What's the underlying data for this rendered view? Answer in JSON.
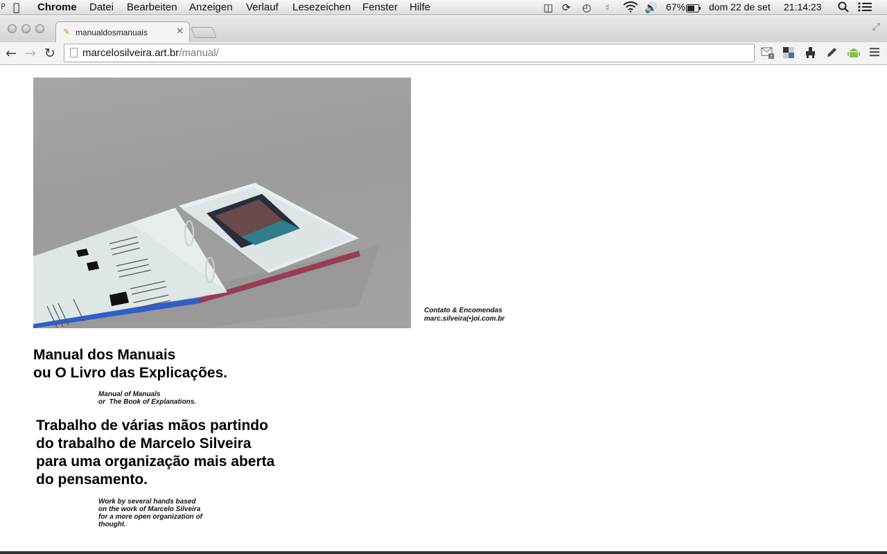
{
  "menubar": {
    "app": "Chrome",
    "items": [
      "Datei",
      "Bearbeiten",
      "Anzeigen",
      "Verlauf",
      "Lesezeichen",
      "Fenster",
      "Hilfe"
    ],
    "battery": "67%",
    "date": "dom 22 de set",
    "time": "21:14:23",
    "icons": [
      "apple-logo",
      "html5-icon",
      "sync-icon",
      "time-machine-icon",
      "bluetooth-icon",
      "wifi-icon",
      "volume-icon",
      "battery-icon",
      "spotlight-icon",
      "notification-list-icon"
    ]
  },
  "tab": {
    "title": "manualdosmanuais"
  },
  "toolbar": {
    "url_host": "marcelosilveira.art.br",
    "url_path": "/manual/"
  },
  "page": {
    "contact_title": "Contato & Encomendas",
    "contact_email": "marc.silveira(•)oi.com.br",
    "title_line1": "Manual dos Manuais",
    "title_line2": "ou O Livro das Explicações.",
    "subtitle_en": "Manual of Manuals\nor  The Book of Explanations.",
    "description_pt": "Trabalho de várias mãos partindo do trabalho de Marcelo Silveira para uma organização mais aberta do pensamento.",
    "description_en": "Work by several hands based on the work of Marcelo Silveira for a more open organization of thought.",
    "photo_label": "Photograph of an open ring-binder book on a grey background"
  },
  "colors": {
    "accent_blue": "#2255cc",
    "menubar_bg": "#dcdcdc",
    "photo_bg": "#a2a2a2"
  }
}
